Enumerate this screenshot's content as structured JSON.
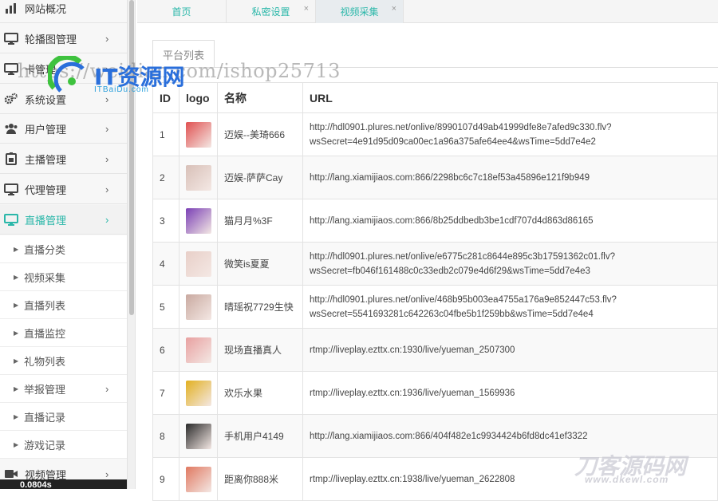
{
  "sidebar": {
    "items": [
      {
        "label": "网站概况",
        "icon": "bar-chart-icon",
        "arrow": ""
      },
      {
        "label": "轮播图管理",
        "icon": "monitor-icon",
        "arrow": "›"
      },
      {
        "label": "卡管理",
        "icon": "monitor-icon",
        "arrow": "›"
      },
      {
        "label": "系统设置",
        "icon": "gears-icon",
        "arrow": "›"
      },
      {
        "label": "用户管理",
        "icon": "users-icon",
        "arrow": "›"
      },
      {
        "label": "主播管理",
        "icon": "badge-icon",
        "arrow": "›"
      },
      {
        "label": "代理管理",
        "icon": "monitor-icon",
        "arrow": "›"
      },
      {
        "label": "直播管理",
        "icon": "monitor-icon",
        "arrow": "›"
      }
    ],
    "sub_items": [
      {
        "label": "直播分类",
        "arrow": ""
      },
      {
        "label": "视频采集",
        "arrow": ""
      },
      {
        "label": "直播列表",
        "arrow": ""
      },
      {
        "label": "直播监控",
        "arrow": ""
      },
      {
        "label": "礼物列表",
        "arrow": ""
      },
      {
        "label": "举报管理",
        "arrow": "›"
      },
      {
        "label": "直播记录",
        "arrow": ""
      },
      {
        "label": "游戏记录",
        "arrow": ""
      }
    ],
    "last_item": {
      "label": "视频管理",
      "arrow": "›"
    },
    "bottom_badge": "0.0804s"
  },
  "tabs": [
    {
      "label": "首页",
      "closable": false
    },
    {
      "label": "私密设置",
      "closable": true
    },
    {
      "label": "视频采集",
      "closable": true
    }
  ],
  "close_glyph": "×",
  "platform_button": "平台列表",
  "table": {
    "headers": [
      "ID",
      "logo",
      "名称",
      "URL"
    ],
    "rows": [
      {
        "id": "1",
        "name": "迈娱--美琦666",
        "url1": "http://hdl0901.plures.net/onlive/8990107d49ab41999dfe8e7afed9c330.flv?",
        "url2": "wsSecret=4e91d95d09ca00ec1a96a375afe64ee4&wsTime=5dd7e4e2",
        "thumb_color": "#e05050"
      },
      {
        "id": "2",
        "name": "迈娱-萨萨Cay",
        "url1": "http://lang.xiamijiaos.com:866/2298bc6c7c18ef53a45896e121f9b949",
        "url2": "",
        "thumb_color": "#d8c0b8"
      },
      {
        "id": "3",
        "name": "猫月月%3F",
        "url1": "http://lang.xiamijiaos.com:866/8b25ddbedb3be1cdf707d4d863d86165",
        "url2": "",
        "thumb_color": "#7a3fb5"
      },
      {
        "id": "4",
        "name": "微笑is夏夏",
        "url1": "http://hdl0901.plures.net/onlive/e6775c281c8644e895c3b17591362c01.flv?",
        "url2": "wsSecret=fb046f161488c0c33edb2c079e4d6f29&wsTime=5dd7e4e3",
        "thumb_color": "#e8cfc8"
      },
      {
        "id": "5",
        "name": "晴瑶祝7729生快",
        "url1": "http://hdl0901.plures.net/onlive/468b95b003ea4755a176a9e852447c53.flv?",
        "url2": "wsSecret=5541693281c642263c04fbe5b1f259bb&wsTime=5dd7e4e4",
        "thumb_color": "#c9a9a0"
      },
      {
        "id": "6",
        "name": "现场直播真人",
        "url1": "rtmp://liveplay.ezttx.cn:1930/live/yueman_2507300",
        "url2": "",
        "thumb_color": "#e8a0a0"
      },
      {
        "id": "7",
        "name": "欢乐水果",
        "url1": "rtmp://liveplay.ezttx.cn:1936/live/yueman_1569936",
        "url2": "",
        "thumb_color": "#e2b020"
      },
      {
        "id": "8",
        "name": "手机用户4149",
        "url1": "http://lang.xiamijiaos.com:866/404f482e1c9934424b6fd8dc41ef3322",
        "url2": "",
        "thumb_color": "#2a2a2a"
      },
      {
        "id": "9",
        "name": "距离你888米",
        "url1": "rtmp://liveplay.ezttx.cn:1938/live/yueman_2622808",
        "url2": "",
        "thumb_color": "#e07860"
      }
    ]
  },
  "watermarks": {
    "url_text": "https://weidian.com/ishop25713",
    "logo_text": "IT资源网",
    "logo_sub": "ITBaiDu.com",
    "corner_text": "刀客源码网",
    "corner_sub": "www.dkewl.com"
  },
  "colors": {
    "accent": "#2ab7a9"
  }
}
